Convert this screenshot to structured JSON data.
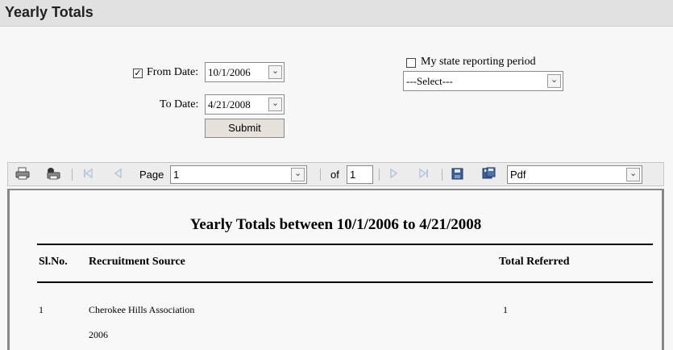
{
  "page": {
    "title": "Yearly Totals"
  },
  "filters": {
    "from_checked_mark": "✓",
    "from_label": "From Date:",
    "from_value": "10/1/2006",
    "to_label": "To Date:",
    "to_value": "4/21/2008",
    "submit_label": "Submit",
    "state_label": "My state reporting period",
    "state_select": "---Select---",
    "dropdown_arrow": "⌄"
  },
  "toolbar": {
    "page_label": "Page",
    "page_value": "1",
    "of_label": "of",
    "of_value": "1",
    "format_value": "Pdf",
    "icons": [
      "print-icon",
      "print-setup-icon",
      "first-page-icon",
      "previous-page-icon",
      "next-page-icon",
      "last-page-icon",
      "save-icon",
      "export-icon"
    ]
  },
  "report": {
    "title": "Yearly Totals between 10/1/2006 to 4/21/2008",
    "columns": [
      "Sl.No.",
      "Recruitment Source",
      "Total Referred"
    ],
    "rows": [
      {
        "slno": "1",
        "source": "Cherokee Hills Association",
        "total": "1"
      },
      {
        "slno": "",
        "source": "2006",
        "total": ""
      }
    ]
  }
}
